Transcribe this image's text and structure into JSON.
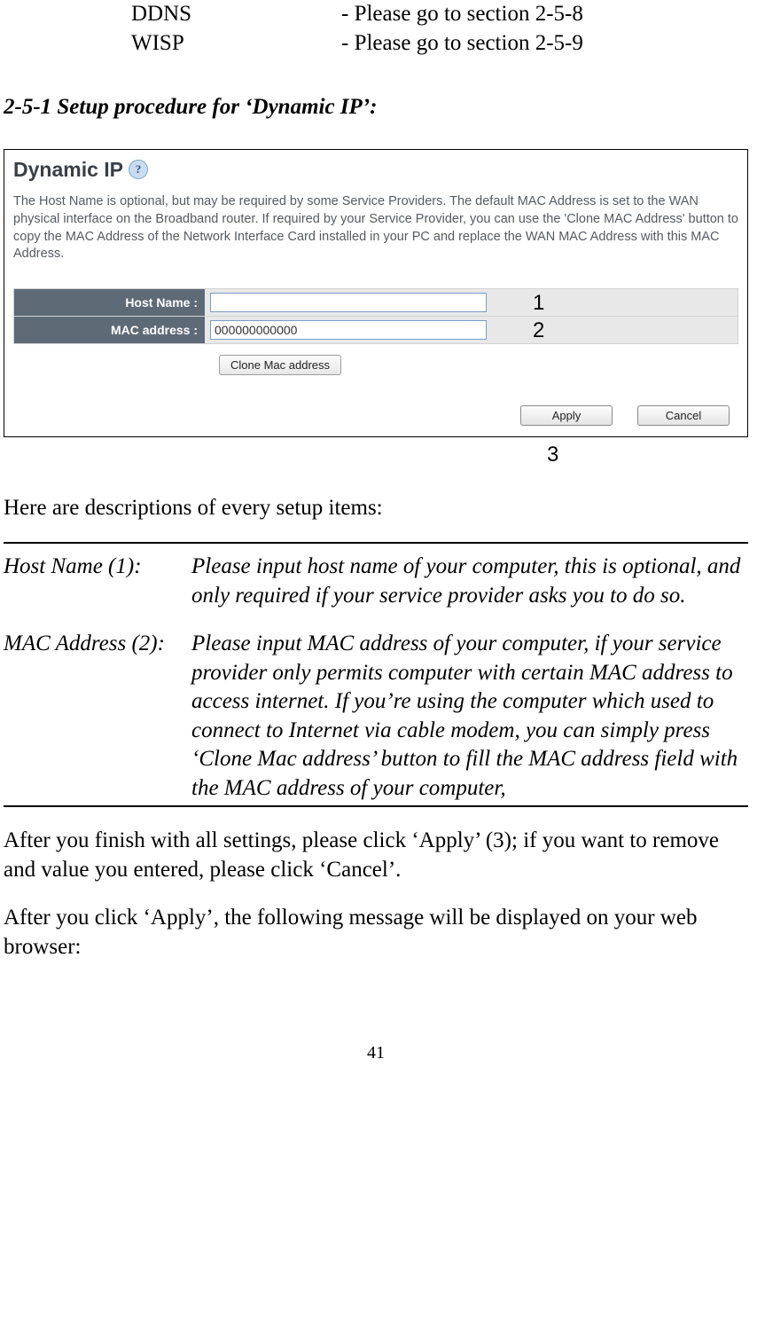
{
  "toc": [
    {
      "term": "DDNS",
      "ref": "- Please go to section 2-5-8"
    },
    {
      "term": "WISP",
      "ref": "- Please go to section 2-5-9"
    }
  ],
  "section_heading": "2-5-1 Setup procedure for ‘Dynamic IP’:",
  "screenshot": {
    "title": "Dynamic IP",
    "help_icon_label": "?",
    "description": "The Host Name is optional, but may be required by some Service Providers. The default MAC Address is set to the WAN physical interface on the Broadband router. If required by your Service Provider, you can use the 'Clone MAC Address' button to copy the MAC Address of the Network Interface Card installed in your PC and replace the WAN MAC Address with this MAC Address.",
    "fields": {
      "host_name_label": "Host Name :",
      "host_name_value": "",
      "mac_label": "MAC address :",
      "mac_value": "000000000000"
    },
    "clone_button": "Clone Mac address",
    "apply_button": "Apply",
    "cancel_button": "Cancel",
    "callouts": {
      "one": "1",
      "two": "2",
      "three": "3"
    }
  },
  "intro_line": "Here are descriptions of every setup items:",
  "definitions": [
    {
      "term": "Host Name (1):",
      "desc": "Please input host name of your computer, this is optional, and only required if your service provider asks you to do so."
    },
    {
      "term": "MAC Address (2):",
      "desc": "Please input MAC address of your computer, if your service provider only permits computer with certain MAC address to access internet. If you’re using the computer which used to connect to Internet via cable modem, you can simply press ‘Clone Mac address’ button to fill the MAC address field with the MAC address of your computer,"
    }
  ],
  "para_after_1": "After you finish with all settings, please click ‘Apply’ (3); if you want to remove and value you entered, please click ‘Cancel’.",
  "para_after_2": "After you click ‘Apply’, the following message will be displayed on your web browser:",
  "page_number": "41"
}
